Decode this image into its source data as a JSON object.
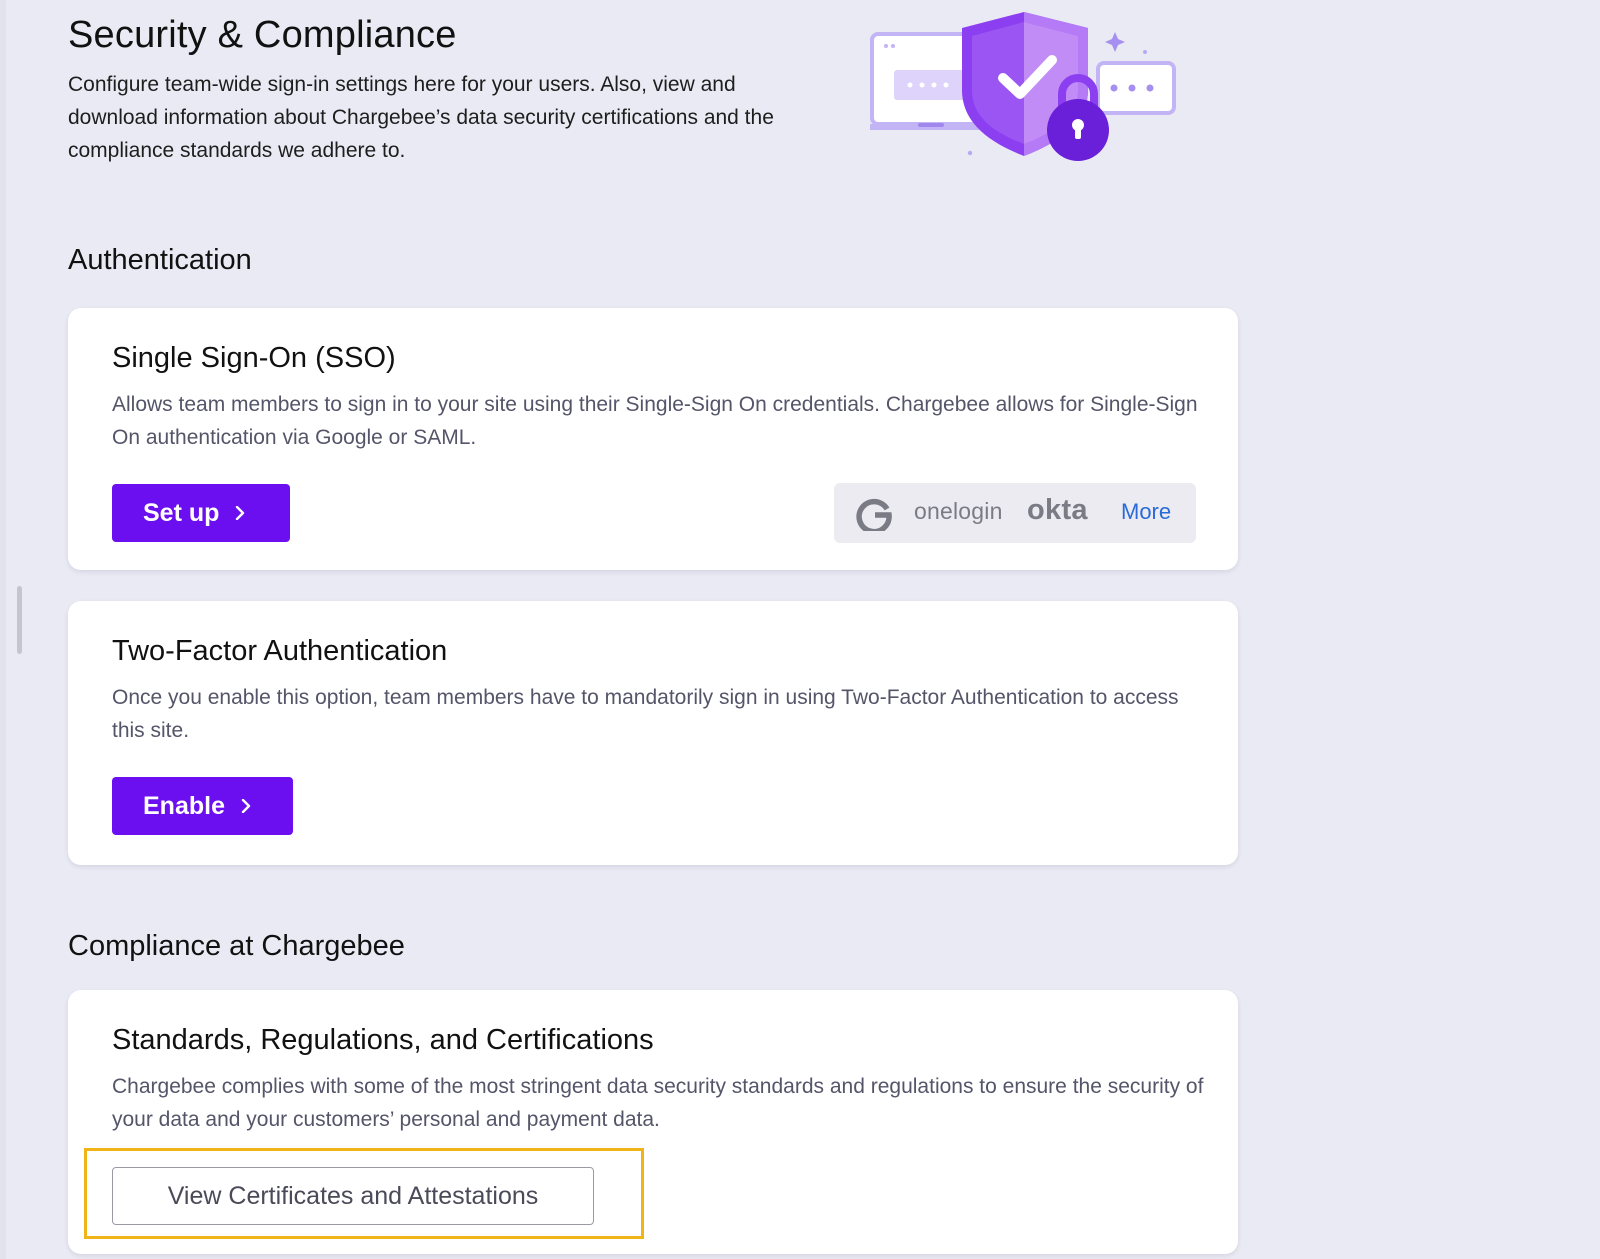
{
  "header": {
    "title": "Security & Compliance",
    "description": "Configure team-wide sign-in settings here for your users. Also, view and download information about Chargebee’s data security certifications and the compliance standards we adhere to."
  },
  "authentication": {
    "section_title": "Authentication",
    "sso": {
      "title": "Single Sign-On (SSO)",
      "description": "Allows team members to sign in to your site using their Single-Sign On credentials. Chargebee allows for Single-Sign On authentication via Google or SAML.",
      "button_label": "Set up",
      "providers": {
        "onelogin": "onelogin",
        "okta": "okta",
        "more_label": "More"
      }
    },
    "two_factor": {
      "title": "Two-Factor Authentication",
      "description": "Once you enable this option, team members have to mandatorily sign in using Two-Factor Authentication to access this site.",
      "button_label": "Enable"
    }
  },
  "compliance": {
    "section_title": "Compliance at Chargebee",
    "standards": {
      "title": "Standards, Regulations, and Certifications",
      "description": "Chargebee complies with some of the most stringent data security standards and regulations to ensure the security of your data and your customers’ personal and payment data.",
      "button_label": "View Certificates and Attestations"
    }
  },
  "colors": {
    "accent": "#6b0ef0",
    "link": "#2a6ad9",
    "highlight": "#f0b419",
    "background": "#eaeaf4"
  },
  "icons": {
    "hero": "security-shield-lock-illustration",
    "google": "google-icon",
    "chevron": "chevron-right-icon"
  }
}
